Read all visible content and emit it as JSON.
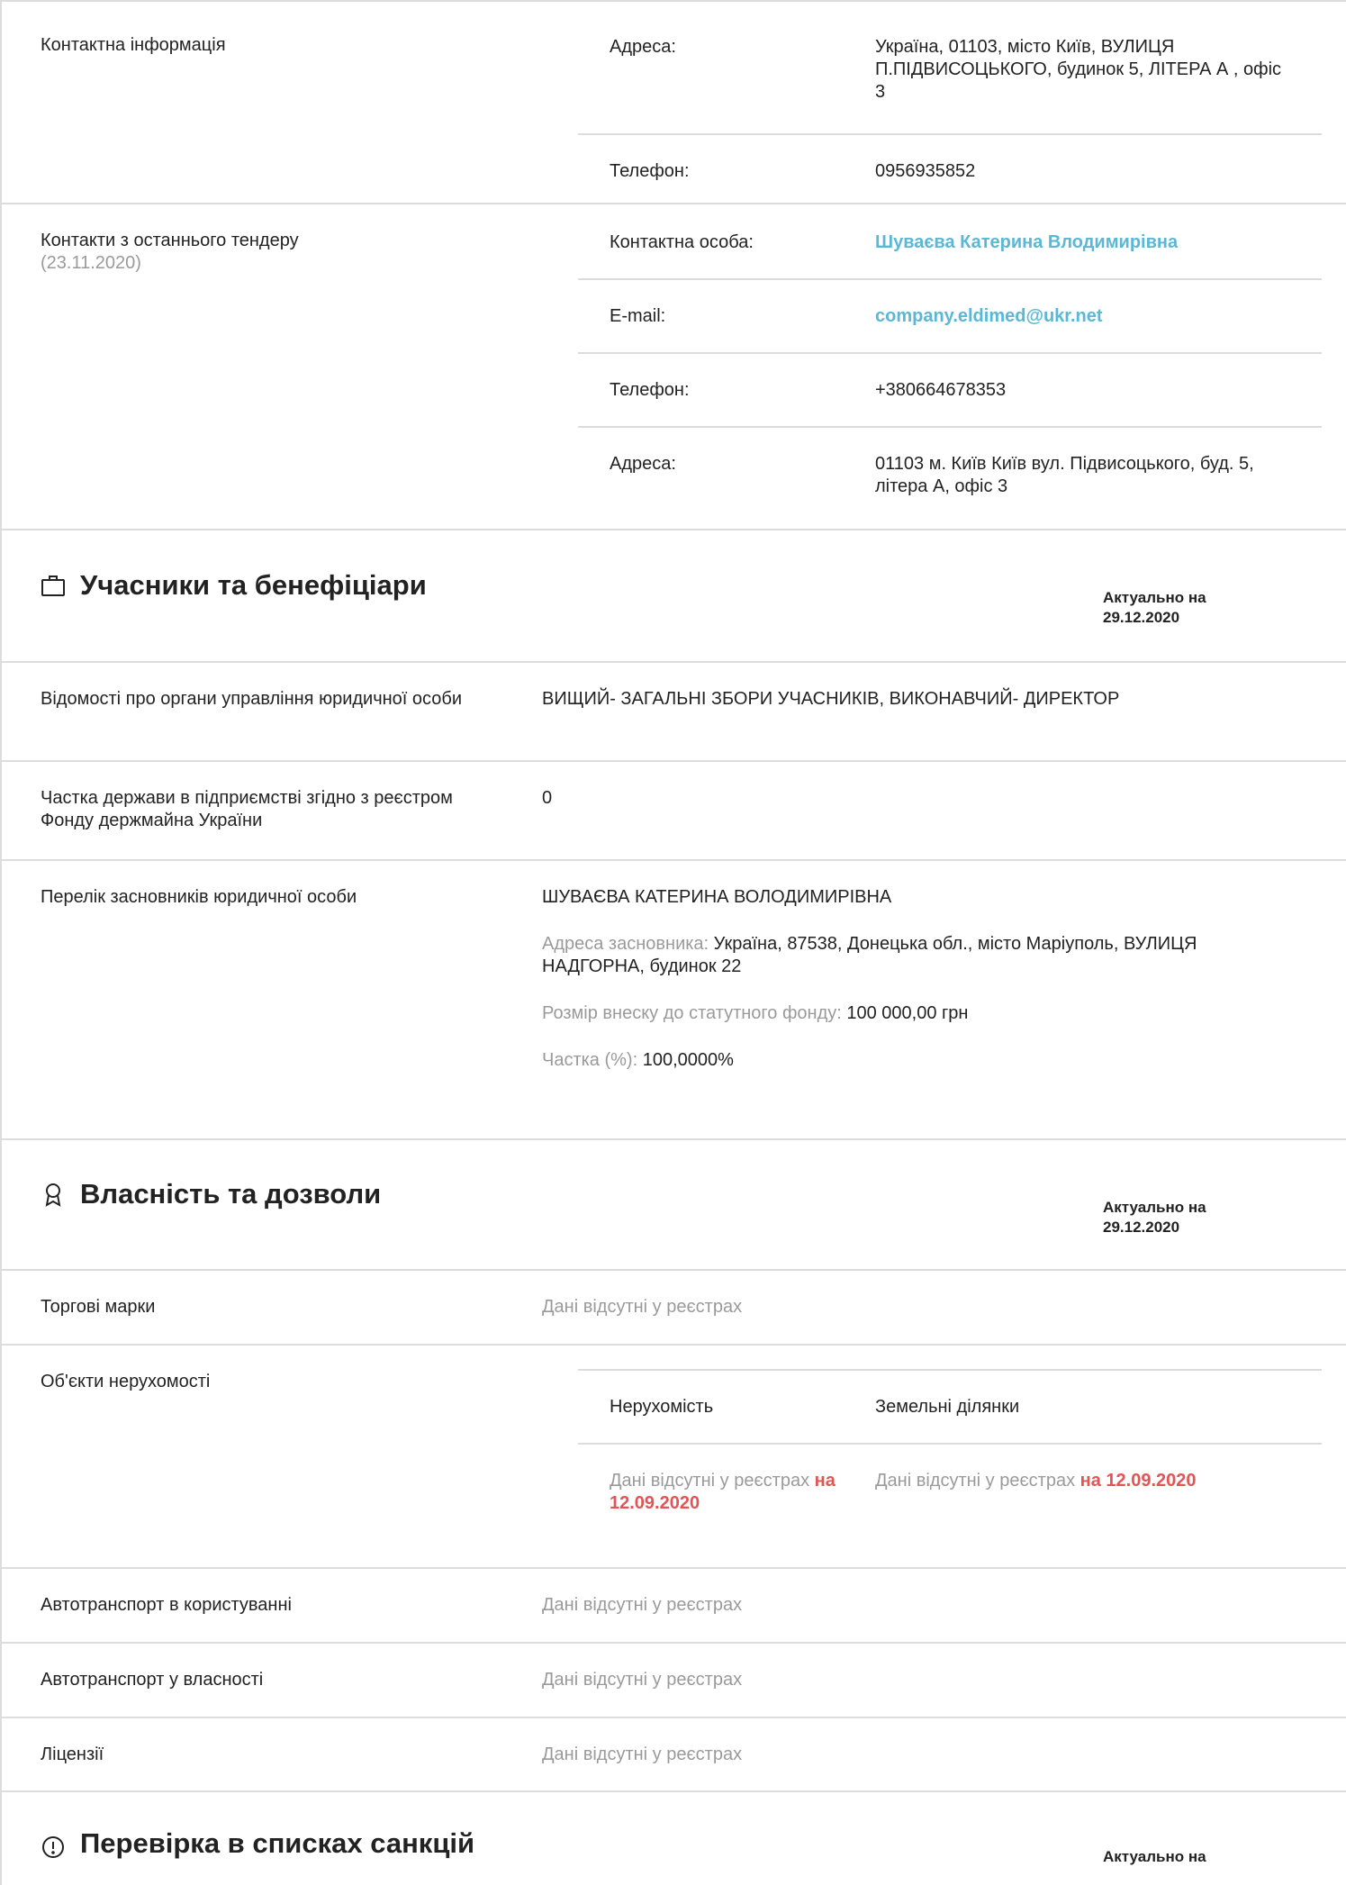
{
  "contact_info": {
    "label": "Контактна інформація",
    "address_key": "Адреса:",
    "address_value": "Україна, 01103, місто Київ, ВУЛИЦЯ П.ПІДВИСОЦЬКОГО, будинок 5, ЛІТЕРА А , офіс 3",
    "phone_key": "Телефон:",
    "phone_value": "0956935852"
  },
  "last_tender": {
    "label": "Контакти з останнього тендеру",
    "date": "(23.11.2020)",
    "person_key": "Контактна особа:",
    "person_value": "Шуваєва Катерина Влодимирівна",
    "email_key": "E-mail:",
    "email_value": "company.eldimed@ukr.net",
    "phone_key": "Телефон:",
    "phone_value": "+380664678353",
    "address_key": "Адреса:",
    "address_value": "01103 м. Київ Київ вул. Підвисоцького, буд. 5, літера А, офіс 3"
  },
  "participants": {
    "title": "Учасники та бенефіціари",
    "actual_label": "Актуально на",
    "actual_date": "29.12.2020",
    "governance_label": "Відомості про органи управління юридичної особи",
    "governance_value": "ВИЩИЙ- ЗАГАЛЬНІ ЗБОРИ УЧАСНИКІВ, ВИКОНАВЧИЙ- ДИРЕКТОР",
    "state_share_label": "Частка держави в підприємстві згідно з реєстром Фонду держмайна України",
    "state_share_value": "0",
    "founders_label": "Перелік засновників юридичної особи",
    "founder_name": "ШУВАЄВА КАТЕРИНА ВОЛОДИМИРІВНА",
    "founder_address_key": "Адреса засновника:",
    "founder_address_value": "Україна, 87538, Донецька обл., місто Маріуполь, ВУЛИЦЯ НАДГОРНА, будинок 22",
    "contribution_key": "Розмір внеску до статутного фонду:",
    "contribution_value": "100 000,00 грн",
    "share_key": "Частка (%):",
    "share_value": "100,0000%"
  },
  "property": {
    "title": "Власність та дозволи",
    "actual_label": "Актуально на",
    "actual_date": "29.12.2020",
    "trademarks_label": "Торгові марки",
    "no_data": "Дані відсутні у реєстрах",
    "realty_label": "Об'єкти нерухомості",
    "realty_col1": "Нерухомість",
    "realty_col2": "Земельні ділянки",
    "realty_date": "на 12.09.2020",
    "vehicles_use_label": "Автотранспорт в користуванні",
    "vehicles_own_label": "Автотранспорт у власності",
    "licenses_label": "Ліцензії"
  },
  "sanctions": {
    "title": "Перевірка в списках санкцій",
    "actual_label": "Актуально на"
  }
}
